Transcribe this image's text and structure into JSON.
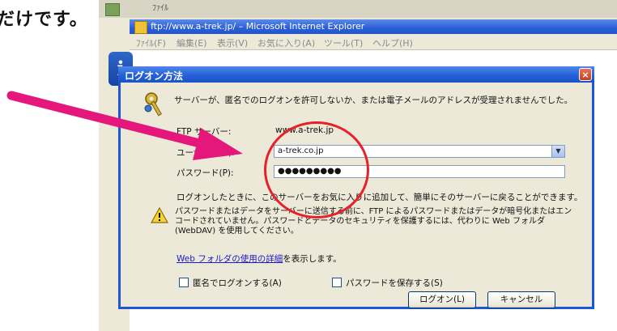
{
  "caption": "だけです。",
  "ie": {
    "title": "ftp://www.a-trek.jp/ – Microsoft Internet Explorer",
    "top_strip_text": "ﾌｧｲﾙ",
    "menu": [
      "ﾌｧｲﾙ(F)",
      "編集(E)",
      "表示(V)",
      "お気に入り(A)",
      "ツール(T)",
      "ヘルプ(H)"
    ]
  },
  "dialog": {
    "title": "ログオン方法",
    "close": "×",
    "message": "サーバーが、匿名でのログオンを許可しないか、または電子メールのアドレスが受理されませんでした。",
    "ftp_server_label": "FTP サーバー:",
    "ftp_server_value": "www.a-trek.jp",
    "user_label": "ユーザー名(U):",
    "user_value": "a-trek.co.jp",
    "password_label": "パスワード(P):",
    "password_value": "●●●●●●●●●",
    "info_text": "ログオンしたときに、このサーバーをお気に入りに追加して、簡単にそのサーバーに戻ることができます。",
    "warning_text": "パスワードまたはデータをサーバーに送信する前に、FTP によるパスワードまたはデータが暗号化またはエンコードされていません。パスワードとデータのセキュリティを保護するには、代わりに Web フォルダ (WebDAV) を使用してください。",
    "help_link": "Web フォルダの使用の詳細",
    "help_suffix": "を表示します。",
    "anon_label": "匿名でログオンする(A)",
    "save_pw_label": "パスワードを保存する(S)",
    "logon_button": "ログオン(L)",
    "cancel_button": "キャンセル"
  },
  "colors": {
    "accent": "#2461d8",
    "annotation_circle": "#e8202a",
    "arrow": "#e6177a"
  },
  "icons": [
    "info-icon",
    "key-icon",
    "warning-icon",
    "close-icon",
    "chevron-down-icon"
  ]
}
